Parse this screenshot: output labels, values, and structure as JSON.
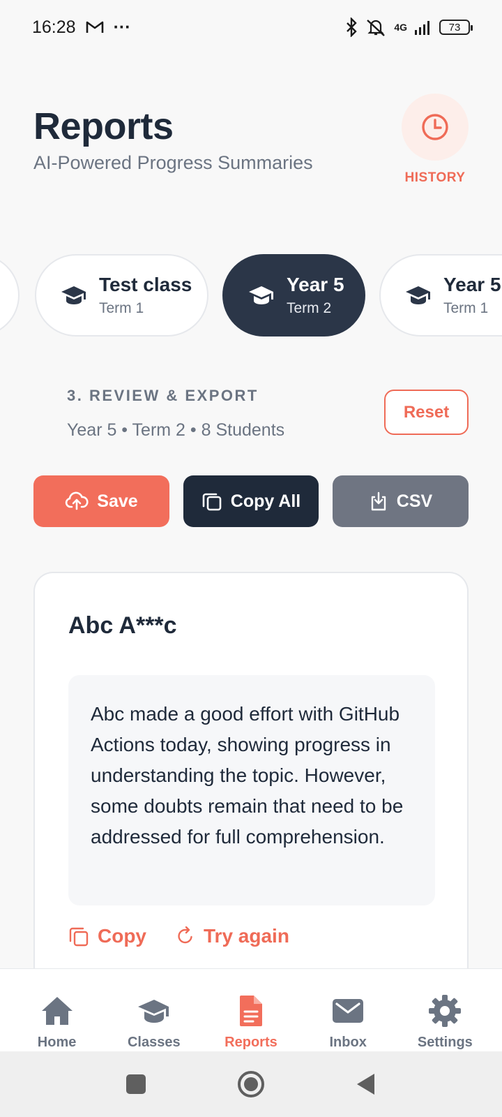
{
  "status_bar": {
    "time": "16:28",
    "dots": "···",
    "network": "4G",
    "battery": "73",
    "icons": [
      "gmail-icon",
      "bluetooth-icon",
      "mute-icon",
      "signal-icon",
      "battery-icon"
    ]
  },
  "header": {
    "title": "Reports",
    "subtitle": "AI-Powered Progress Summaries",
    "history_label": "HISTORY"
  },
  "classes": [
    {
      "name": "Test class",
      "term": "Term 1",
      "active": false
    },
    {
      "name": "Year 5",
      "term": "Term 2",
      "active": true
    },
    {
      "name": "Year 5",
      "term": "Term 1",
      "active": false
    }
  ],
  "step": {
    "title": "3. REVIEW & EXPORT",
    "subtitle": "Year 5 • Term 2 • 8 Students",
    "reset_label": "Reset"
  },
  "actions": {
    "save_label": "Save",
    "copy_all_label": "Copy All",
    "csv_label": "CSV"
  },
  "report": {
    "student_name": "Abc A***c",
    "text": "Abc made a good effort with GitHub Actions today, showing progress in understanding the topic. However, some doubts remain that need to be addressed for full comprehension.",
    "copy_label": "Copy",
    "try_again_label": "Try again"
  },
  "bottom_nav": [
    {
      "label": "Home",
      "icon": "home-icon",
      "active": false
    },
    {
      "label": "Classes",
      "icon": "graduation-cap-icon",
      "active": false
    },
    {
      "label": "Reports",
      "icon": "document-icon",
      "active": true
    },
    {
      "label": "Inbox",
      "icon": "mail-icon",
      "active": false
    },
    {
      "label": "Settings",
      "icon": "gear-icon",
      "active": false
    }
  ],
  "colors": {
    "accent": "#f26e5b",
    "dark": "#1f2a3a",
    "grey_button": "#6f7582",
    "muted_text": "#6b7482"
  }
}
